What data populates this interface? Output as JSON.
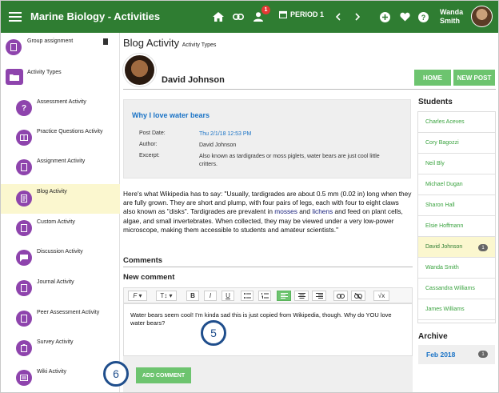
{
  "app": {
    "title": "Marine Biology - Activities"
  },
  "topbar": {
    "notification_count": "1",
    "period_label": "PERIOD 1",
    "user_name_line1": "Wanda",
    "user_name_line2": "Smith"
  },
  "sidebar": {
    "items": [
      {
        "label": "Group assignment",
        "icon": "document-icon"
      },
      {
        "label": "Activity Types",
        "icon": "folder-icon"
      },
      {
        "label": "Assessment Activity",
        "icon": "question-icon"
      },
      {
        "label": "Practice Questions Activity",
        "icon": "book-icon"
      },
      {
        "label": "Assignment Activity",
        "icon": "document-icon"
      },
      {
        "label": "Blog Activity",
        "icon": "blog-icon"
      },
      {
        "label": "Custom Activity",
        "icon": "document-icon"
      },
      {
        "label": "Discussion Activity",
        "icon": "chat-icon"
      },
      {
        "label": "Journal Activity",
        "icon": "document-icon"
      },
      {
        "label": "Peer Assessment Activity",
        "icon": "document-icon"
      },
      {
        "label": "Survey Activity",
        "icon": "clipboard-icon"
      },
      {
        "label": "Wiki Activity",
        "icon": "list-icon"
      }
    ]
  },
  "page": {
    "heading": "Blog Activity",
    "subheading": "Activity Types",
    "author_name": "David Johnson",
    "home_button": "HOME",
    "new_post_button": "NEW POST"
  },
  "post": {
    "title": "Why I love water bears",
    "date_label": "Post Date:",
    "date_value": "Thu 2/1/18 12:53 PM",
    "author_label": "Author:",
    "author_value": "David Johnson",
    "excerpt_label": "Excerpt:",
    "excerpt_value": "Also known as tardigrades or moss piglets, water bears are just cool little critters.",
    "body_part1": "Here's what Wikipedia has to say: \"Usually, tardigrades are about 0.5 mm (0.02 in) long when they are fully grown. They are short and plump, with four pairs of legs, each with four to eight claws also known as \"disks\". Tardigrades are prevalent in ",
    "body_link1": "mosses",
    "body_and": " and ",
    "body_link2": "lichens",
    "body_part2": " and feed on plant cells, algae, and small invertebrates. When collected, they may be viewed under a very low-power microscope, making them accessible to students and amateur scientists.\""
  },
  "comments": {
    "heading": "Comments",
    "new_heading": "New comment",
    "editor_text": "Water bears seem cool! I'm kinda sad this is just copied from Wikipedia, though. Why do YOU love water bears?",
    "add_button": "ADD COMMENT",
    "callout_5": "5",
    "callout_6": "6"
  },
  "toolbar": {
    "font_label": "F",
    "size_label": "T↕",
    "bold": "B",
    "italic": "I",
    "underline": "U",
    "formula": "√x"
  },
  "students": {
    "heading": "Students",
    "list": [
      {
        "name": "Charles Aceves"
      },
      {
        "name": "Cory Bagozzi"
      },
      {
        "name": "Neil Bly"
      },
      {
        "name": "Michael Dugan"
      },
      {
        "name": "Sharon Hall"
      },
      {
        "name": "Elsie Hoffmann"
      },
      {
        "name": "David Johnson",
        "count": "1"
      },
      {
        "name": "Wanda Smith"
      },
      {
        "name": "Cassandra Williams"
      },
      {
        "name": "James Williams"
      }
    ]
  },
  "archive": {
    "heading": "Archive",
    "month": "Feb 2018",
    "count": "1"
  },
  "colors": {
    "topbar": "#2f7d32",
    "accent_green": "#6dc46f",
    "sidebar_icon": "#8e44ad",
    "link_blue": "#1a73c6",
    "active_highlight": "#fbf7cf"
  }
}
